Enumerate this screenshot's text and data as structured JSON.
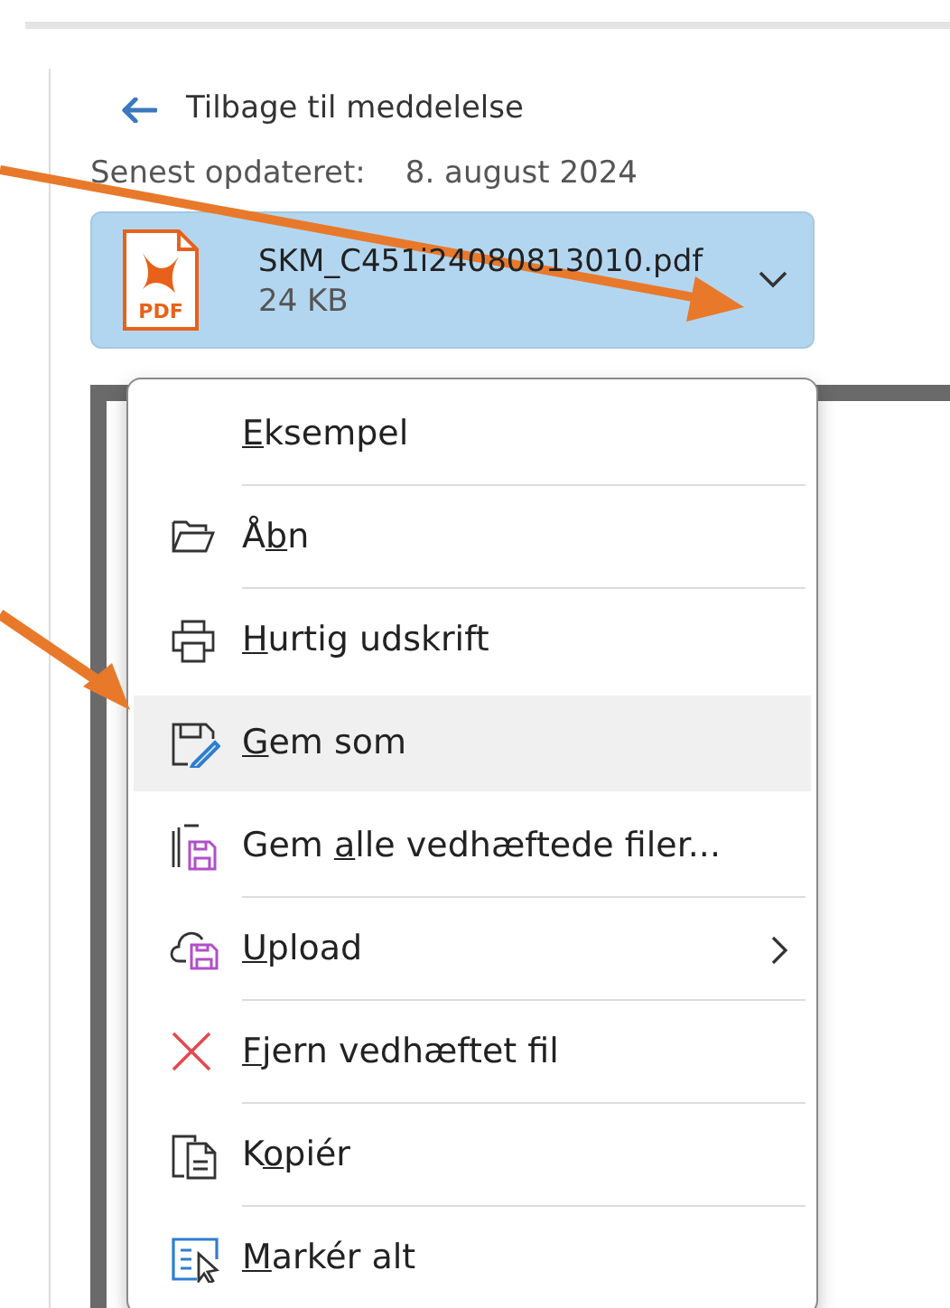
{
  "back_link": {
    "label": "Tilbage til meddelelse"
  },
  "updated": {
    "label": "Senest opdateret:",
    "value": "8. august 2024"
  },
  "attachment": {
    "file_type": "PDF",
    "name": "SKM_C451i24080813010.pdf",
    "size": "24 KB"
  },
  "context_menu": {
    "items": [
      {
        "kind": "none",
        "key": "E",
        "after": "ksempel",
        "selected": false,
        "submenu": false
      },
      {
        "kind": "open",
        "before": "Å",
        "key": "b",
        "after": "n",
        "selected": false,
        "submenu": false
      },
      {
        "kind": "print",
        "key": "H",
        "after": "urtig udskrift",
        "selected": false,
        "submenu": false
      },
      {
        "kind": "save-as",
        "key": "G",
        "after": "em som",
        "selected": true,
        "submenu": false
      },
      {
        "kind": "save-all",
        "before": "Gem ",
        "key": "a",
        "after": "lle vedhæftede filer...",
        "selected": false,
        "submenu": false
      },
      {
        "kind": "upload",
        "key": "U",
        "after": "pload",
        "selected": false,
        "submenu": true
      },
      {
        "kind": "remove",
        "key": "F",
        "after": "jern vedhæftet fil",
        "selected": false,
        "submenu": false
      },
      {
        "kind": "copy",
        "before": "K",
        "key": "o",
        "after": "piér",
        "selected": false,
        "submenu": false
      },
      {
        "kind": "select-all",
        "key": "M",
        "after": "arkér alt",
        "selected": false,
        "submenu": false
      }
    ]
  }
}
